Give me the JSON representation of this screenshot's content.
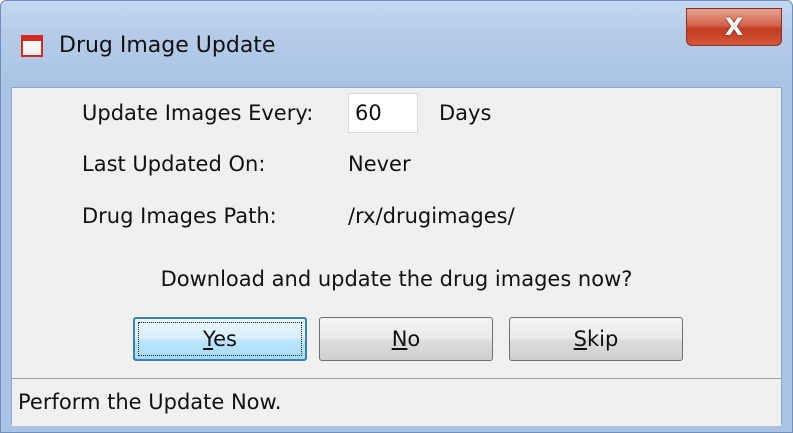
{
  "window": {
    "title": "Drug Image Update",
    "close_label": "X",
    "icon": "app-window-icon"
  },
  "form": {
    "update_every_label": "Update Images Every:",
    "update_every_value": "60",
    "update_every_unit": "Days",
    "last_updated_label": "Last Updated On:",
    "last_updated_value": "Never",
    "path_label": "Drug Images Path:",
    "path_value": "/rx/drugimages/"
  },
  "prompt": {
    "question": "Download and update the drug images now?"
  },
  "buttons": {
    "yes": {
      "mnemonic": "Y",
      "rest": "es"
    },
    "no": {
      "mnemonic": "N",
      "rest": "o"
    },
    "skip": {
      "mnemonic": "S",
      "rest": "kip"
    }
  },
  "status_bar": {
    "text": "Perform the Update Now."
  },
  "colors": {
    "title_bar": "#b6cde9",
    "close_button": "#c23b22",
    "client_bg": "#f0f0f0",
    "default_button_border": "#3c7fb1"
  }
}
